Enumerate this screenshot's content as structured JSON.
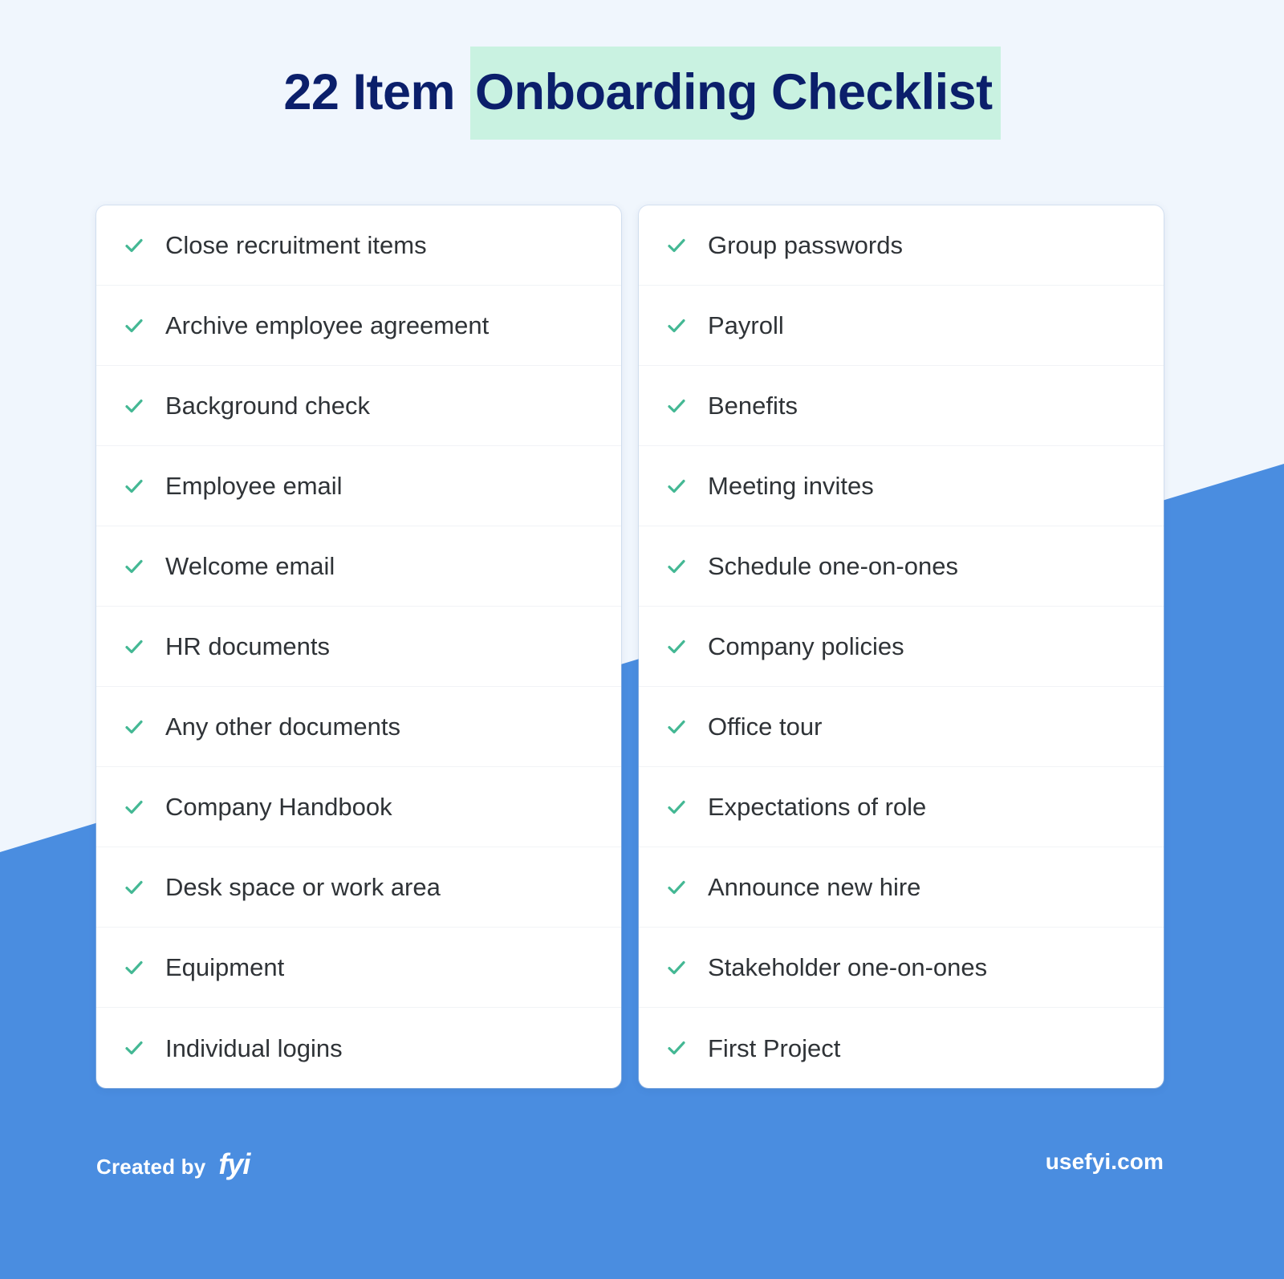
{
  "title": {
    "prefix": "22 Item ",
    "highlight": "Onboarding Checklist",
    "text_color": "#0b1f6b",
    "highlight_color": "#c9f2e1"
  },
  "theme": {
    "page_background": "#f0f6fd",
    "accent_blue": "#4a8de0",
    "check_color": "#44b894",
    "card_background": "#ffffff",
    "row_text_color": "#2f3337",
    "divider_color": "#f1f3f6"
  },
  "checklist": {
    "icon": "check-icon",
    "columns": [
      {
        "name": "left-column",
        "items": [
          "Close recruitment items",
          "Archive employee agreement",
          "Background check",
          "Employee email",
          "Welcome email",
          "HR documents",
          "Any other documents",
          "Company Handbook",
          "Desk space or work area",
          "Equipment",
          "Individual logins"
        ]
      },
      {
        "name": "right-column",
        "items": [
          "Group passwords",
          "Payroll",
          "Benefits",
          "Meeting invites",
          "Schedule one-on-ones",
          "Company policies",
          "Office tour",
          "Expectations of role",
          "Announce new hire",
          "Stakeholder one-on-ones",
          "First Project"
        ]
      }
    ]
  },
  "footer": {
    "created_by_label": "Created by",
    "brand": "fyi",
    "website": "usefyi.com"
  }
}
